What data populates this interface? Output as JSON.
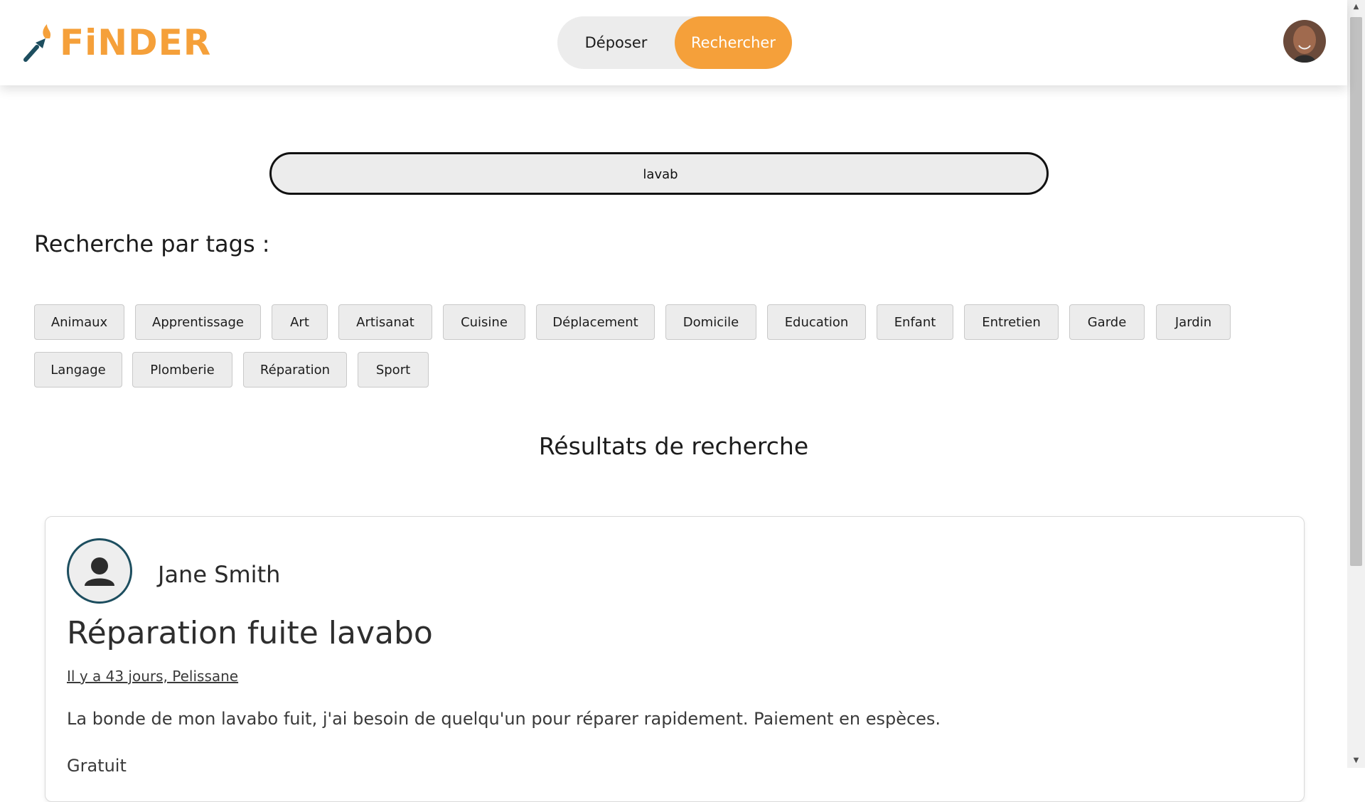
{
  "brand": {
    "name": "FiNDER",
    "accent": "#f5a03a"
  },
  "header": {
    "toggle": {
      "depot_label": "Déposer",
      "search_label": "Rechercher",
      "active": "Rechercher"
    }
  },
  "search": {
    "value": "lavab"
  },
  "tags_section": {
    "title": "Recherche par tags :",
    "tags": [
      "Animaux",
      "Apprentissage",
      "Art",
      "Artisanat",
      "Cuisine",
      "Déplacement",
      "Domicile",
      "Education",
      "Enfant",
      "Entretien",
      "Garde",
      "Jardin",
      "Langage",
      "Plomberie",
      "Réparation",
      "Sport"
    ]
  },
  "results": {
    "title": "Résultats de recherche",
    "items": [
      {
        "user": "Jane Smith",
        "title": "Réparation fuite lavabo",
        "meta": "Il y a 43 jours, Pelissane",
        "description": "La bonde de mon lavabo fuit, j'ai besoin de quelqu'un pour réparer rapidement. Paiement en espèces.",
        "price": "Gratuit"
      }
    ]
  }
}
